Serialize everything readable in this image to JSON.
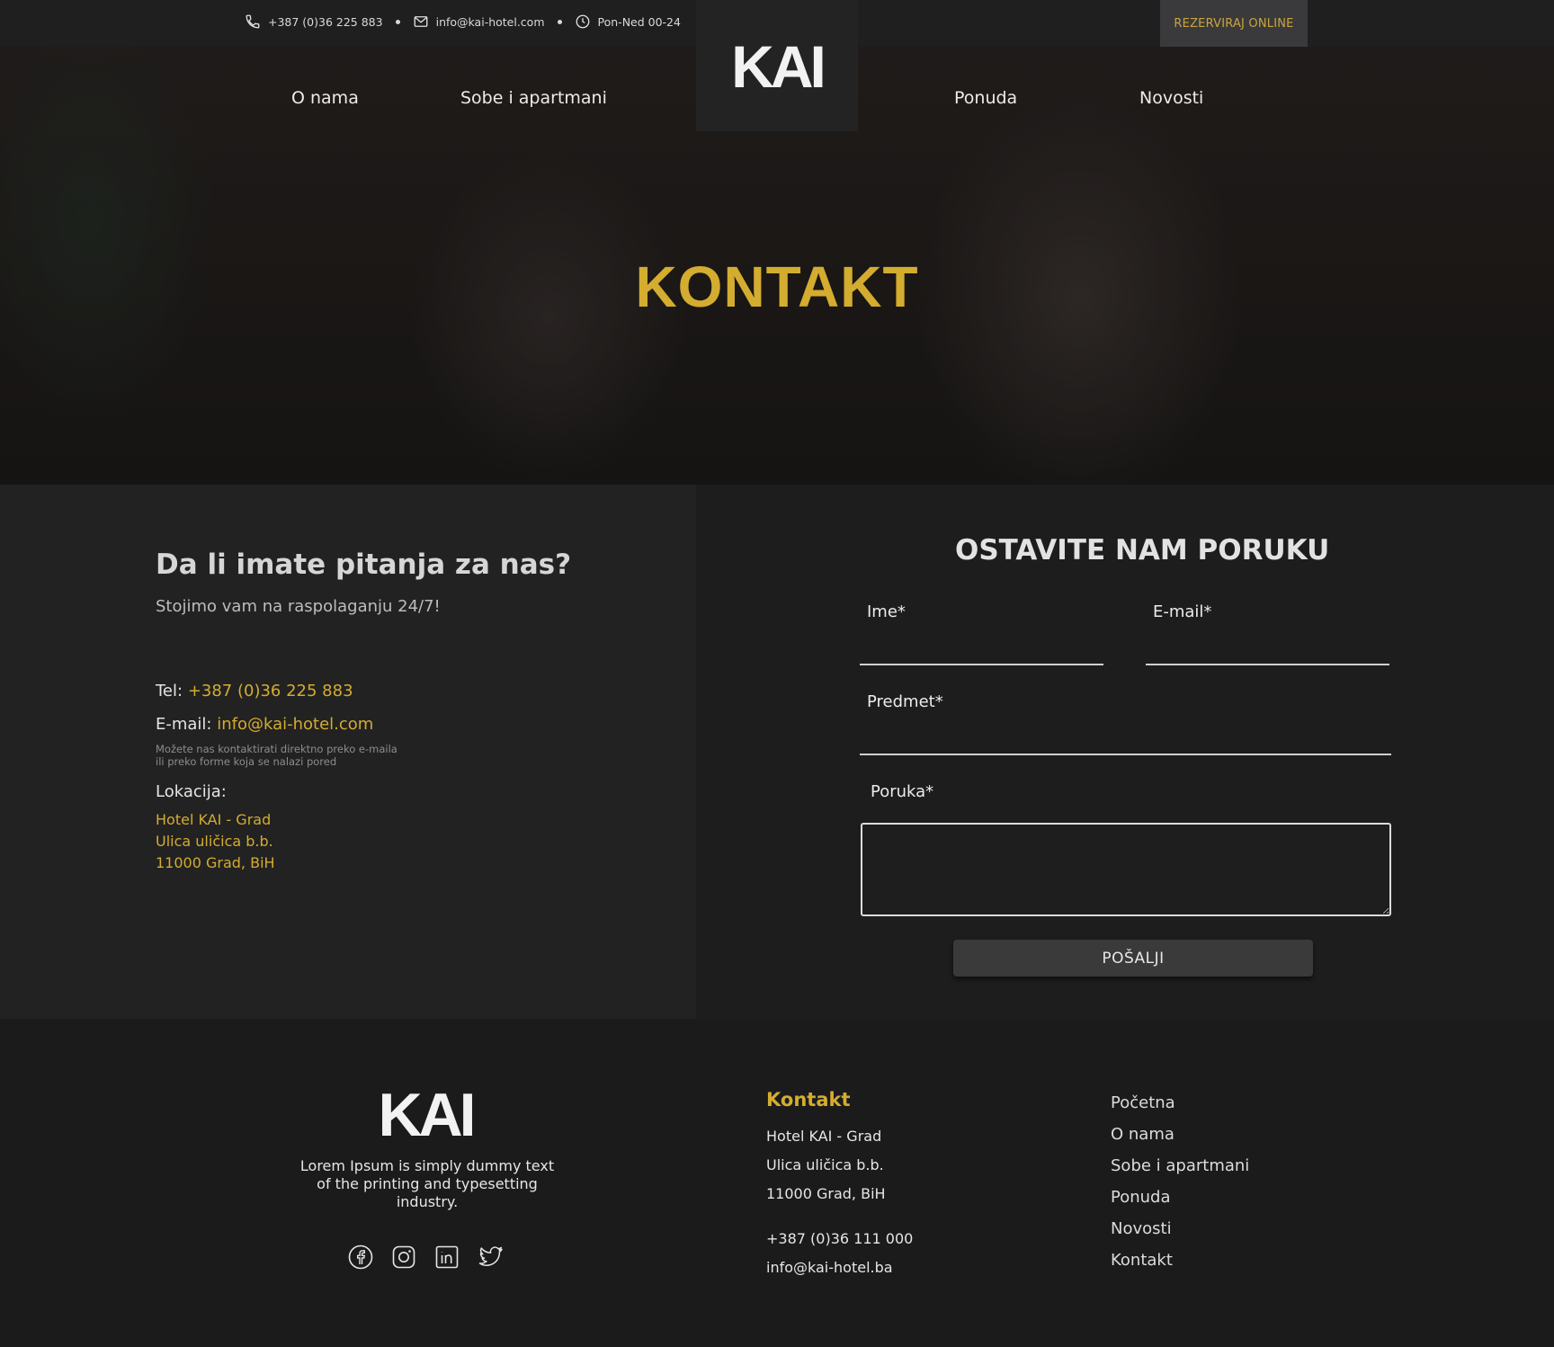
{
  "topbar": {
    "phone": "+387 (0)36 225 883",
    "email": "info@kai-hotel.com",
    "hours": "Pon-Ned 00-24",
    "reserve_label": "REZERVIRAJ ONLINE"
  },
  "logo": {
    "text": "KAI"
  },
  "nav": {
    "items": [
      "O nama",
      "Sobe i apartmani",
      "Ponuda",
      "Novosti"
    ]
  },
  "hero": {
    "title": "KONTAKT"
  },
  "contact": {
    "heading": "Da li imate pitanja za nas?",
    "subheading": "Stojimo vam na raspolaganju 24/7!",
    "tel_label": "Tel:",
    "tel_value": "+387 (0)36 225  883",
    "email_label": "E-mail:",
    "email_value": "info@kai-hotel.com",
    "note_line1": "Možete nas kontaktirati direktno preko e-maila",
    "note_line2": "ili preko forme koja se nalazi pored",
    "location_label": "Lokacija:",
    "location_lines": [
      "Hotel KAI - Grad",
      "Ulica uličica b.b.",
      "11000 Grad, BiH"
    ]
  },
  "form": {
    "title": "OSTAVITE NAM PORUKU",
    "name_label": "Ime*",
    "email_label": "E-mail*",
    "subject_label": "Predmet*",
    "message_label": "Poruka*",
    "submit_label": "POŠALJI"
  },
  "footer": {
    "logo_text": "KAI",
    "description": "Lorem Ipsum is simply dummy text of the printing and typesetting industry.",
    "social_icons": [
      "facebook-icon",
      "instagram-icon",
      "linkedin-icon",
      "twitter-icon"
    ],
    "contact_title": "Kontakt",
    "contact_lines": [
      "Hotel KAI - Grad",
      "Ulica uličica b.b.",
      "11000 Grad, BiH"
    ],
    "phone": "+387 (0)36 111 000",
    "email": "info@kai-hotel.ba",
    "links": [
      "Početna",
      "O nama",
      "Sobe i apartmani",
      "Ponuda",
      "Novosti",
      "Kontakt"
    ],
    "active_link": "Početna"
  },
  "colors": {
    "accent_gold": "#d4ac2f",
    "background": "#1c1c1c"
  }
}
